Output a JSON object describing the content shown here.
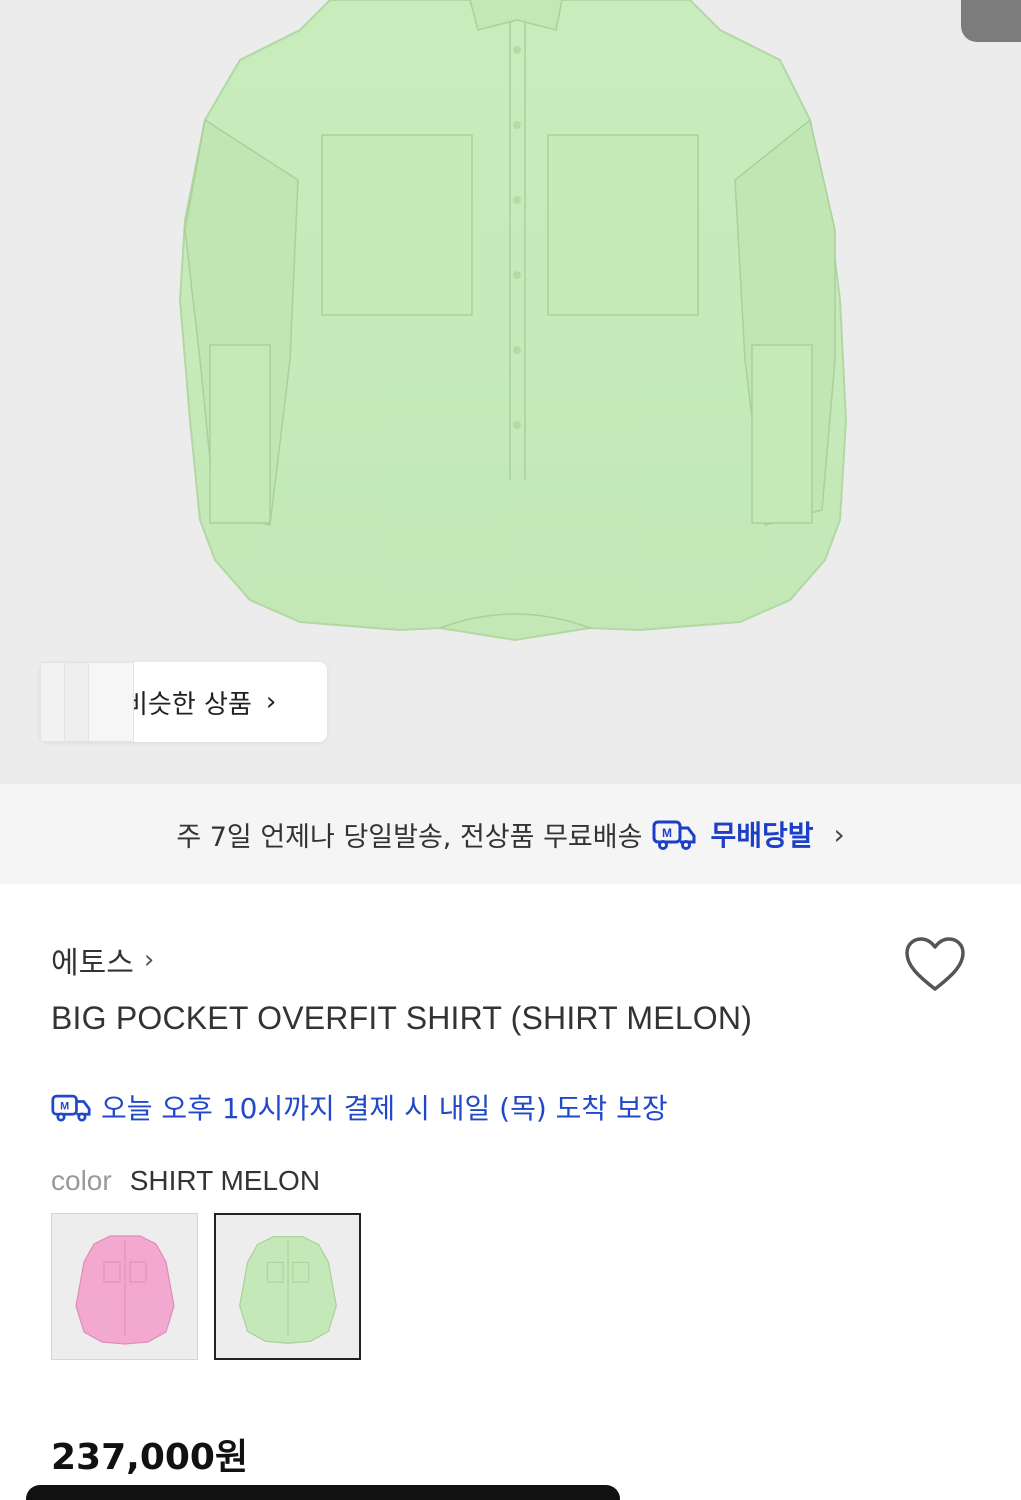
{
  "similar_products": {
    "label": "비슷한 상품"
  },
  "shipping_banner": {
    "text": "주 7일 언제나 당일발송, 전상품 무료배송",
    "brand": "무배당발"
  },
  "product": {
    "brand": "에토스",
    "title": "BIG POCKET OVERFIT SHIRT (SHIRT MELON)",
    "delivery_guarantee": "오늘 오후 10시까지 결제 시 내일 (목) 도착 보장",
    "color_label": "color",
    "color_value": "SHIRT MELON",
    "color_options": [
      {
        "name": "pink",
        "hex": "#f3a8cf",
        "selected": false
      },
      {
        "name": "melon",
        "hex": "#c5e8b8",
        "selected": true
      }
    ],
    "price": "237,000원"
  },
  "colors": {
    "accent_blue": "#1c3fc8",
    "shirt_melon": "#c9ecbd",
    "shirt_pink": "#f3a8cf"
  },
  "icons": {
    "delivery": "truck-icon",
    "wishlist": "heart-icon",
    "chevron": "chevron-right-icon"
  }
}
